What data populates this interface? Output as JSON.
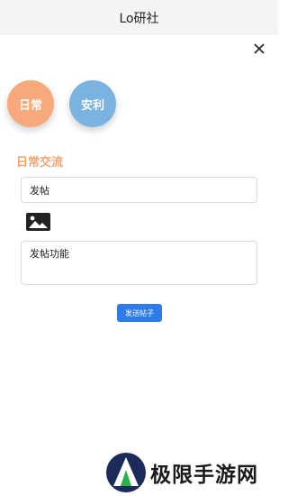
{
  "header": {
    "title": "Lo研社"
  },
  "close_icon": "close-icon",
  "categories": [
    {
      "label": "日常",
      "color": "#f7a97b"
    },
    {
      "label": "安利",
      "color": "#7ab3df"
    }
  ],
  "section": {
    "title": "日常交流",
    "title_color": "#eea574"
  },
  "form": {
    "title_value": "发帖",
    "image_icon": "image-icon",
    "content_value": "发帖功能",
    "submit_label": "发送帖子",
    "submit_color": "#2f7bea"
  },
  "watermark": {
    "text": "极限手游网",
    "logo": "watermark-logo"
  },
  "colors": {
    "header_bg": "#f4f4f4",
    "border": "#dcdcdc"
  }
}
